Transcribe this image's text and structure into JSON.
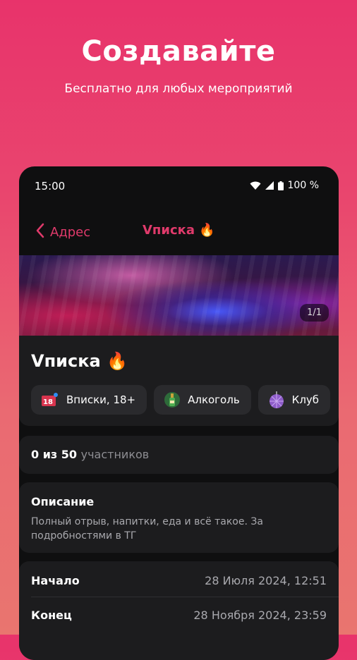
{
  "promo": {
    "headline": "Создавайте",
    "subline": "Бесплатно для любых мероприятий"
  },
  "status_bar": {
    "time": "15:00",
    "battery": "100 %",
    "icons": [
      "wifi-icon",
      "signal-icon",
      "battery-icon"
    ]
  },
  "nav": {
    "back_label": "Адрес",
    "title": "Vписка 🔥"
  },
  "photo": {
    "counter": "1/1"
  },
  "event": {
    "title": "Vписка 🔥",
    "tags": [
      {
        "label": "Вписки, 18+",
        "icon": "18-plus-icon"
      },
      {
        "label": "Алкоголь",
        "icon": "bottle-icon"
      },
      {
        "label": "Клуб",
        "icon": "disco-ball-icon"
      }
    ]
  },
  "participants": {
    "count": "0 из 50",
    "label": "участников"
  },
  "description": {
    "title": "Описание",
    "text": "Полный отрыв, напитки, еда и всё такое.  За подробностями в ТГ"
  },
  "schedule": {
    "start_label": "Начало",
    "start_value": "28 Июля 2024, 12:51",
    "end_label": "Конец",
    "end_value": "28 Ноября 2024, 23:59"
  },
  "colors": {
    "accent": "#e03a6b",
    "background_top": "#e8336b",
    "background_bottom": "#e9756f",
    "card": "#1c1c1e"
  }
}
